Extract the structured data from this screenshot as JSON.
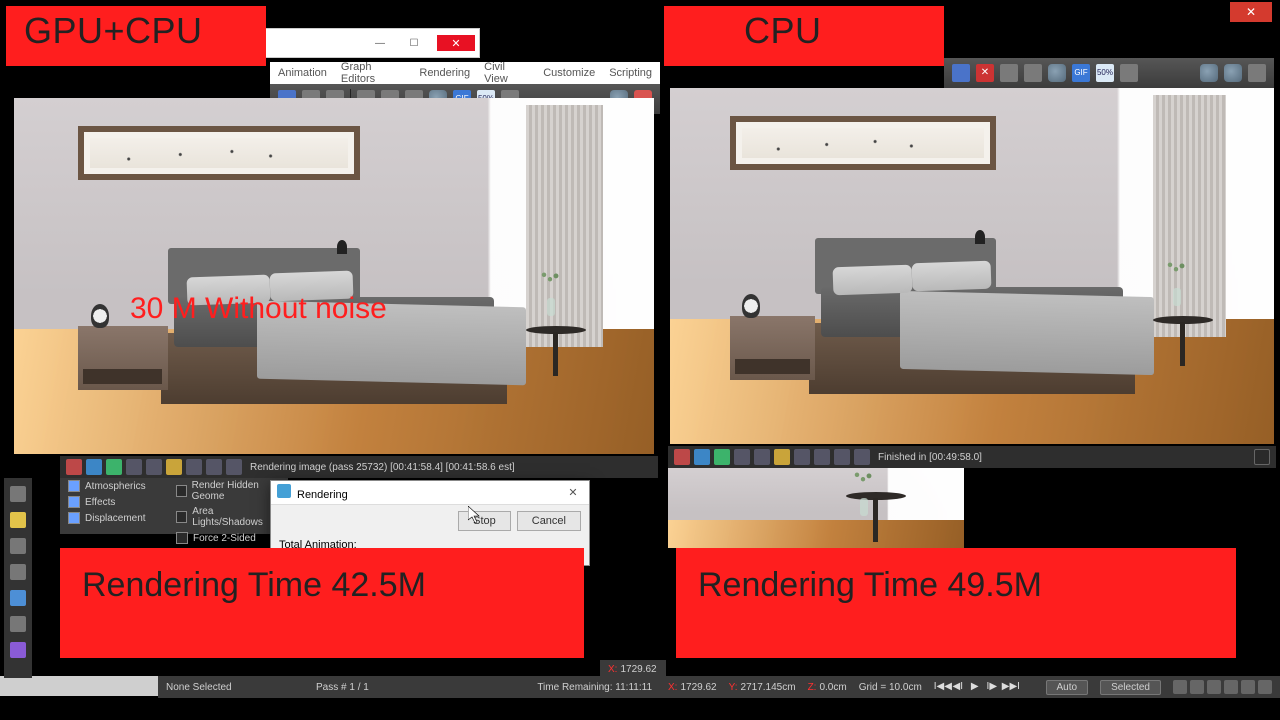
{
  "banners": {
    "left_title": "GPU+CPU",
    "right_title": "CPU"
  },
  "annotation": {
    "without_noise": "30 M Without noise"
  },
  "render_times": {
    "left": "Rendering Time 42.5M",
    "right": "Rendering Time  49.5M"
  },
  "menubar": {
    "items": [
      "Animation",
      "Graph Editors",
      "Rendering",
      "Civil View",
      "Customize",
      "Scripting"
    ]
  },
  "toolbar_labels": {
    "gif": "GIF",
    "fifty": "50%",
    "close_x": "✕"
  },
  "left_thin_toolbar_status": "Rendering image (pass 25732) [00:41:58.4] [00:41:58.6 est]",
  "right_thin_toolbar_status": "Finished in [00:49:58.0]",
  "rollout": {
    "atmospherics": "Atmospherics",
    "effects": "Effects",
    "displacement": "Displacement",
    "hidden_geom": "Render Hidden Geome",
    "area_lights": "Area Lights/Shadows",
    "force2sided": "Force 2-Sided"
  },
  "dialog": {
    "title": "Rendering",
    "total_anim": "Total Animation:",
    "stop": "Stop",
    "cancel": "Cancel"
  },
  "bottom_left": {
    "none_selected": "None Selected",
    "pass": "Pass #   1 / 1",
    "time_remaining": "Time Remaining: 11:11:11"
  },
  "bottom_coords": {
    "x_label": "X:",
    "x_val": "1729.62",
    "y_label": "Y:",
    "y_val": "2717.145cm",
    "z_label": "Z:",
    "z_val": "0.0cm",
    "grid": "Grid = 10.0cm"
  },
  "bottom_right": {
    "auto": "Auto",
    "selected": "Selected"
  }
}
